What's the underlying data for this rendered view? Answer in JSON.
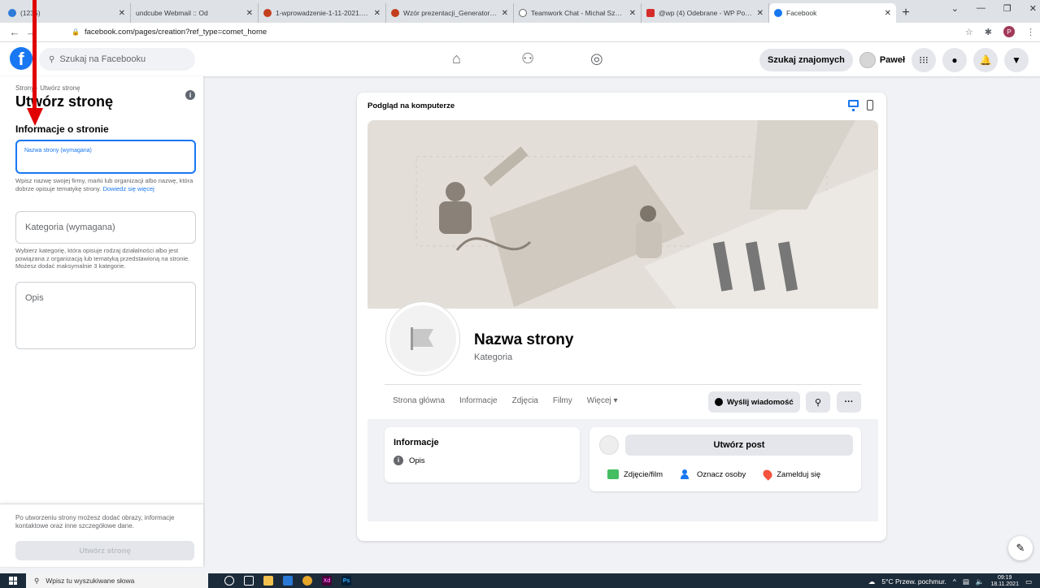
{
  "browser": {
    "tabs": [
      {
        "title": "(1235)",
        "color": "#2f7bd8"
      },
      {
        "title": "undcube Webmail :: Od",
        "color": "#ffffff"
      },
      {
        "title": "1-wprowadzenie-1-11-2021.pptx",
        "color": "#c43e1c"
      },
      {
        "title": "Wzór prezentacji_Generator Inno",
        "color": "#c43e1c"
      },
      {
        "title": "Teamwork Chat - Michał Szordyk",
        "color": "#6c6c6c"
      },
      {
        "title": "@wp (4) Odebrane - WP Poczta",
        "color": "#d62b2b"
      },
      {
        "title": "Facebook",
        "color": "#1877f2"
      }
    ],
    "url": "facebook.com/pages/creation?ref_type=comet_home",
    "profile_initial": "P"
  },
  "fb_header": {
    "logo": "f",
    "search_placeholder": "Szukaj na Facebooku",
    "find_friends": "Szukaj znajomych",
    "user_name": "Paweł"
  },
  "sidebar": {
    "breadcrumb": "Strony · Utwórz stronę",
    "title": "Utwórz stronę",
    "section_title": "Informacje o stronie",
    "page_name_label": "Nazwa strony (wymagana)",
    "page_name_hint": "Wpisz nazwę swojej firmy, marki lub organizacji albo nazwę, która dobrze opisuje tematykę strony.",
    "learn_more": "Dowiedz się więcej",
    "category_label": "Kategoria (wymagana)",
    "category_hint": "Wybierz kategorię, która opisuje rodzaj działalności albo jest powiązana z organizacją lub tematyką przedstawioną na stronie. Możesz dodać maksymalnie 3 kategorie.",
    "description_label": "Opis",
    "bottom_note": "Po utworzeniu strony możesz dodać obrazy, informacje kontaktowe oraz inne szczegółowe dane.",
    "create_button": "Utwórz stronę"
  },
  "preview": {
    "title": "Podgląd na komputerze",
    "page_name": "Nazwa strony",
    "category": "Kategoria",
    "tabs": [
      "Strona główna",
      "Informacje",
      "Zdjęcia",
      "Filmy",
      "Więcej ▾"
    ],
    "send_message": "Wyślij wiadomość",
    "info_title": "Informacje",
    "info_desc": "Opis",
    "create_post": "Utwórz post",
    "actions": [
      "Zdjęcie/film",
      "Oznacz osoby",
      "Zamelduj się"
    ]
  },
  "taskbar": {
    "search_placeholder": "Wpisz tu wyszukiwane słowa",
    "weather": "5°C  Przew. pochmur.",
    "time": "09:19",
    "date": "18.11.2021"
  },
  "colors": {
    "fb_blue": "#1877f2",
    "annotation_arrow": "#e00000"
  }
}
